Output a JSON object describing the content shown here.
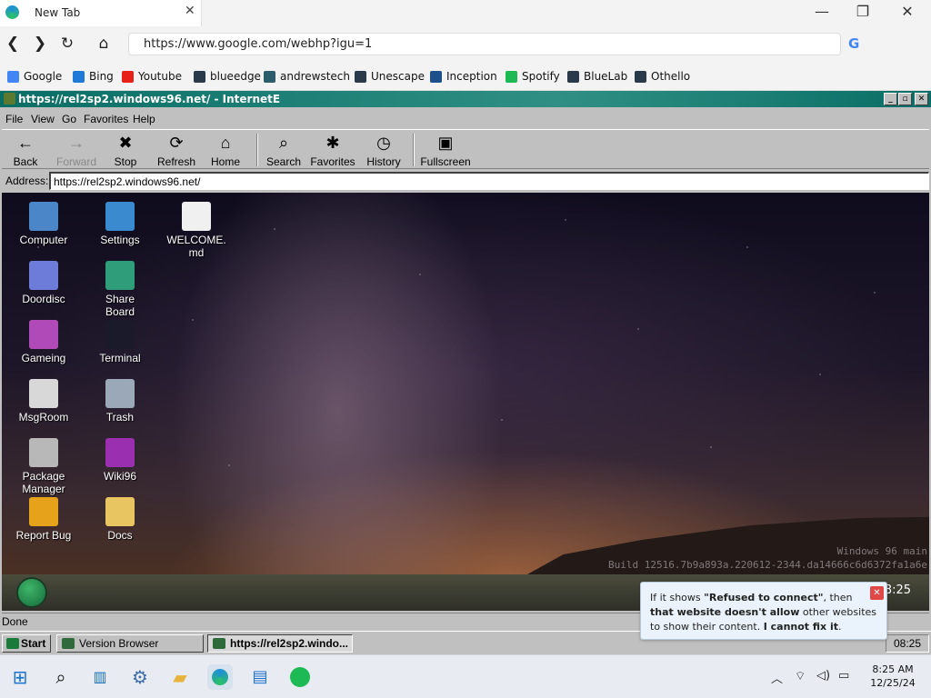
{
  "browser": {
    "tab_title": "New Tab",
    "tab_close": "✕",
    "url": "https://www.google.com/webhp?igu=1",
    "bookmarks": [
      {
        "label": "Google",
        "icon": "google-icon",
        "color": "#4285f4"
      },
      {
        "label": "Bing",
        "icon": "bing-icon",
        "color": "#1e7ad6"
      },
      {
        "label": "Youtube",
        "icon": "youtube-icon",
        "color": "#e62117"
      },
      {
        "label": "blueedge",
        "icon": "app-icon",
        "color": "#2b3a4a"
      },
      {
        "label": "andrewstech",
        "icon": "app-icon",
        "color": "#2c5d6a"
      },
      {
        "label": "Unescape",
        "icon": "app-icon",
        "color": "#2b3a4a"
      },
      {
        "label": "Inception",
        "icon": "app-icon",
        "color": "#1d4f8a"
      },
      {
        "label": "Spotify",
        "icon": "spotify-icon",
        "color": "#1db954"
      },
      {
        "label": "BlueLab",
        "icon": "app-icon",
        "color": "#2b3a4a"
      },
      {
        "label": "Othello",
        "icon": "app-icon",
        "color": "#2b3a4a"
      }
    ]
  },
  "ie": {
    "title": "https://rel2sp2.windows96.net/ - InternetE",
    "menu": [
      "File",
      "View",
      "Go",
      "Favorites",
      "Help"
    ],
    "toolbar": [
      {
        "label": "Back",
        "icon": "←"
      },
      {
        "label": "Forward",
        "icon": "→"
      },
      {
        "label": "Stop",
        "icon": "✖"
      },
      {
        "label": "Refresh",
        "icon": "⟳"
      },
      {
        "label": "Home",
        "icon": "⌂"
      },
      {
        "label": "Search",
        "icon": "⌕"
      },
      {
        "label": "Favorites",
        "icon": "✱"
      },
      {
        "label": "History",
        "icon": "◷"
      },
      {
        "label": "Fullscreen",
        "icon": "▣"
      }
    ],
    "address_label": "Address:",
    "address": "https://rel2sp2.windows96.net/",
    "status": "Done"
  },
  "desktop": {
    "icons": [
      {
        "label": "Computer",
        "icon": "computer-icon",
        "color": "#4a86c8"
      },
      {
        "label": "Settings",
        "icon": "settings-icon",
        "color": "#3a8ad0"
      },
      {
        "label": "WELCOME.\nmd",
        "icon": "document-icon",
        "color": "#f0f0f0"
      },
      {
        "label": "Doordisc",
        "icon": "discord-icon",
        "color": "#6c7cd8"
      },
      {
        "label": "Share\nBoard",
        "icon": "share-icon",
        "color": "#2f9c7a"
      },
      {
        "label": "Gameing",
        "icon": "cube-icon",
        "color": "#b04ab8"
      },
      {
        "label": "Terminal",
        "icon": "terminal-icon",
        "color": "#1a1a2a"
      },
      {
        "label": "MsgRoom",
        "icon": "chat-icon",
        "color": "#d8d8d8"
      },
      {
        "label": "Trash",
        "icon": "trash-icon",
        "color": "#9aa8b8"
      },
      {
        "label": "Package\nManager",
        "icon": "package-icon",
        "color": "#b8b8b8"
      },
      {
        "label": "Wiki96",
        "icon": "book-icon",
        "color": "#9a2fb0"
      },
      {
        "label": "Report Bug",
        "icon": "warning-icon",
        "color": "#e6a21a"
      },
      {
        "label": "Docs",
        "icon": "folder-icon",
        "color": "#e8c560"
      }
    ],
    "build_line1": "Windows 96 main",
    "build_line2": "Build 12516.7b9a893a.220612-2344.da14666c6d6372fa1a6e",
    "clock": "08:25"
  },
  "outer_taskbar": {
    "start": "Start",
    "buttons": [
      "Version Browser",
      "https://rel2sp2.windo..."
    ],
    "clock": "08:25"
  },
  "toast": {
    "p1": "If it shows ",
    "b1": "\"Refused to connect\"",
    "p2": ", then ",
    "b2": "that website doesn't allow",
    "p3": " other websites to show their content. ",
    "b3": "I cannot fix it",
    "p4": "."
  },
  "win_taskbar": {
    "time": "8:25 AM",
    "date": "12/25/24"
  }
}
